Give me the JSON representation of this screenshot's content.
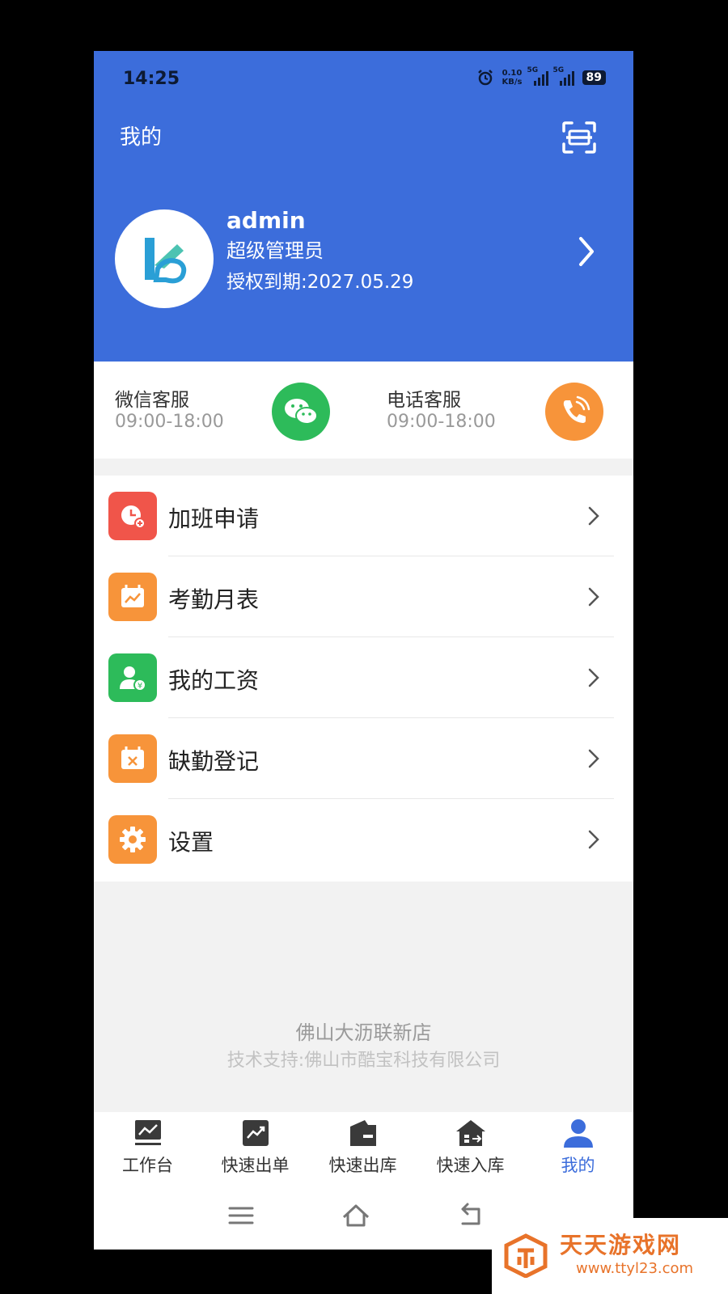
{
  "status_bar": {
    "time": "14:25",
    "net_speed": "0.10",
    "net_unit": "KB/s",
    "sig1": "5G",
    "sig2": "5G",
    "battery": "89"
  },
  "header": {
    "title": "我的"
  },
  "profile": {
    "name": "admin",
    "role": "超级管理员",
    "expiry": "授权到期:2027.05.29"
  },
  "service": {
    "wechat": {
      "label": "微信客服",
      "hours": "09:00-18:00"
    },
    "phone": {
      "label": "电话客服",
      "hours": "09:00-18:00"
    }
  },
  "menu": [
    {
      "label": "加班申请",
      "icon": "overtime-clock-icon",
      "color": "#f0554a"
    },
    {
      "label": "考勤月表",
      "icon": "calendar-chart-icon",
      "color": "#f7943a"
    },
    {
      "label": "我的工资",
      "icon": "salary-user-icon",
      "color": "#2dbb5a"
    },
    {
      "label": "缺勤登记",
      "icon": "calendar-x-icon",
      "color": "#f7943a"
    },
    {
      "label": "设置",
      "icon": "gear-icon",
      "color": "#f7943a"
    }
  ],
  "footer": {
    "store": "佛山大沥联新店",
    "support": "技术支持:佛山市酷宝科技有限公司"
  },
  "tabs": [
    {
      "label": "工作台",
      "icon": "workbench-icon"
    },
    {
      "label": "快速出单",
      "icon": "quick-order-icon"
    },
    {
      "label": "快速出库",
      "icon": "quick-outbound-icon"
    },
    {
      "label": "快速入库",
      "icon": "quick-inbound-icon"
    },
    {
      "label": "我的",
      "icon": "user-icon"
    }
  ],
  "active_tab": "我的",
  "watermark": {
    "title": "天天游戏网",
    "url": "www.ttyl23.com"
  },
  "colors": {
    "primary": "#3c6ddb",
    "wechat": "#2dbb5a",
    "phone": "#f7943a",
    "active_tab": "#3c6ddb"
  }
}
